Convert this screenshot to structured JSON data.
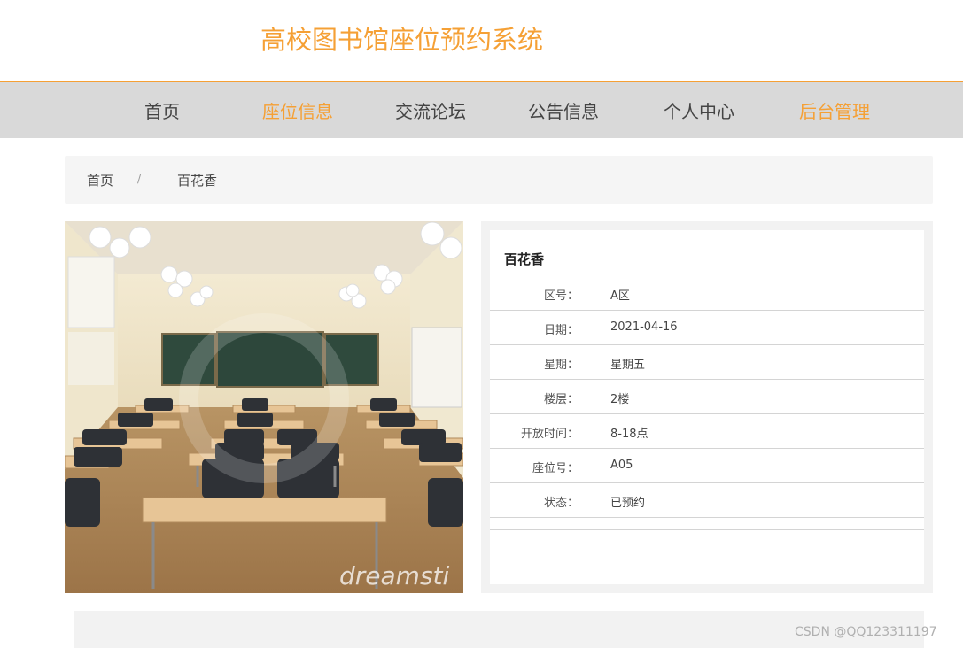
{
  "header": {
    "site_title": "高校图书馆座位预约系统"
  },
  "nav": {
    "items": [
      {
        "label": "首页"
      },
      {
        "label": "座位信息"
      },
      {
        "label": "交流论坛"
      },
      {
        "label": "公告信息"
      },
      {
        "label": "个人中心"
      },
      {
        "label": "后台管理"
      }
    ],
    "accent_color": "#f5a035"
  },
  "breadcrumb": {
    "home": "首页",
    "separator": "/",
    "current": "百花香"
  },
  "photo": {
    "watermark_text": "dreamsti"
  },
  "details": {
    "title": "百花香",
    "rows": [
      {
        "key": "区号：",
        "value": "A区"
      },
      {
        "key": "日期：",
        "value": "2021-04-16"
      },
      {
        "key": "星期：",
        "value": "星期五"
      },
      {
        "key": "楼层：",
        "value": "2楼"
      },
      {
        "key": "开放时间：",
        "value": "8-18点"
      },
      {
        "key": "座位号：",
        "value": "A05"
      },
      {
        "key": "状态：",
        "value": "已预约"
      }
    ]
  },
  "watermark": "CSDN @QQ123311197"
}
